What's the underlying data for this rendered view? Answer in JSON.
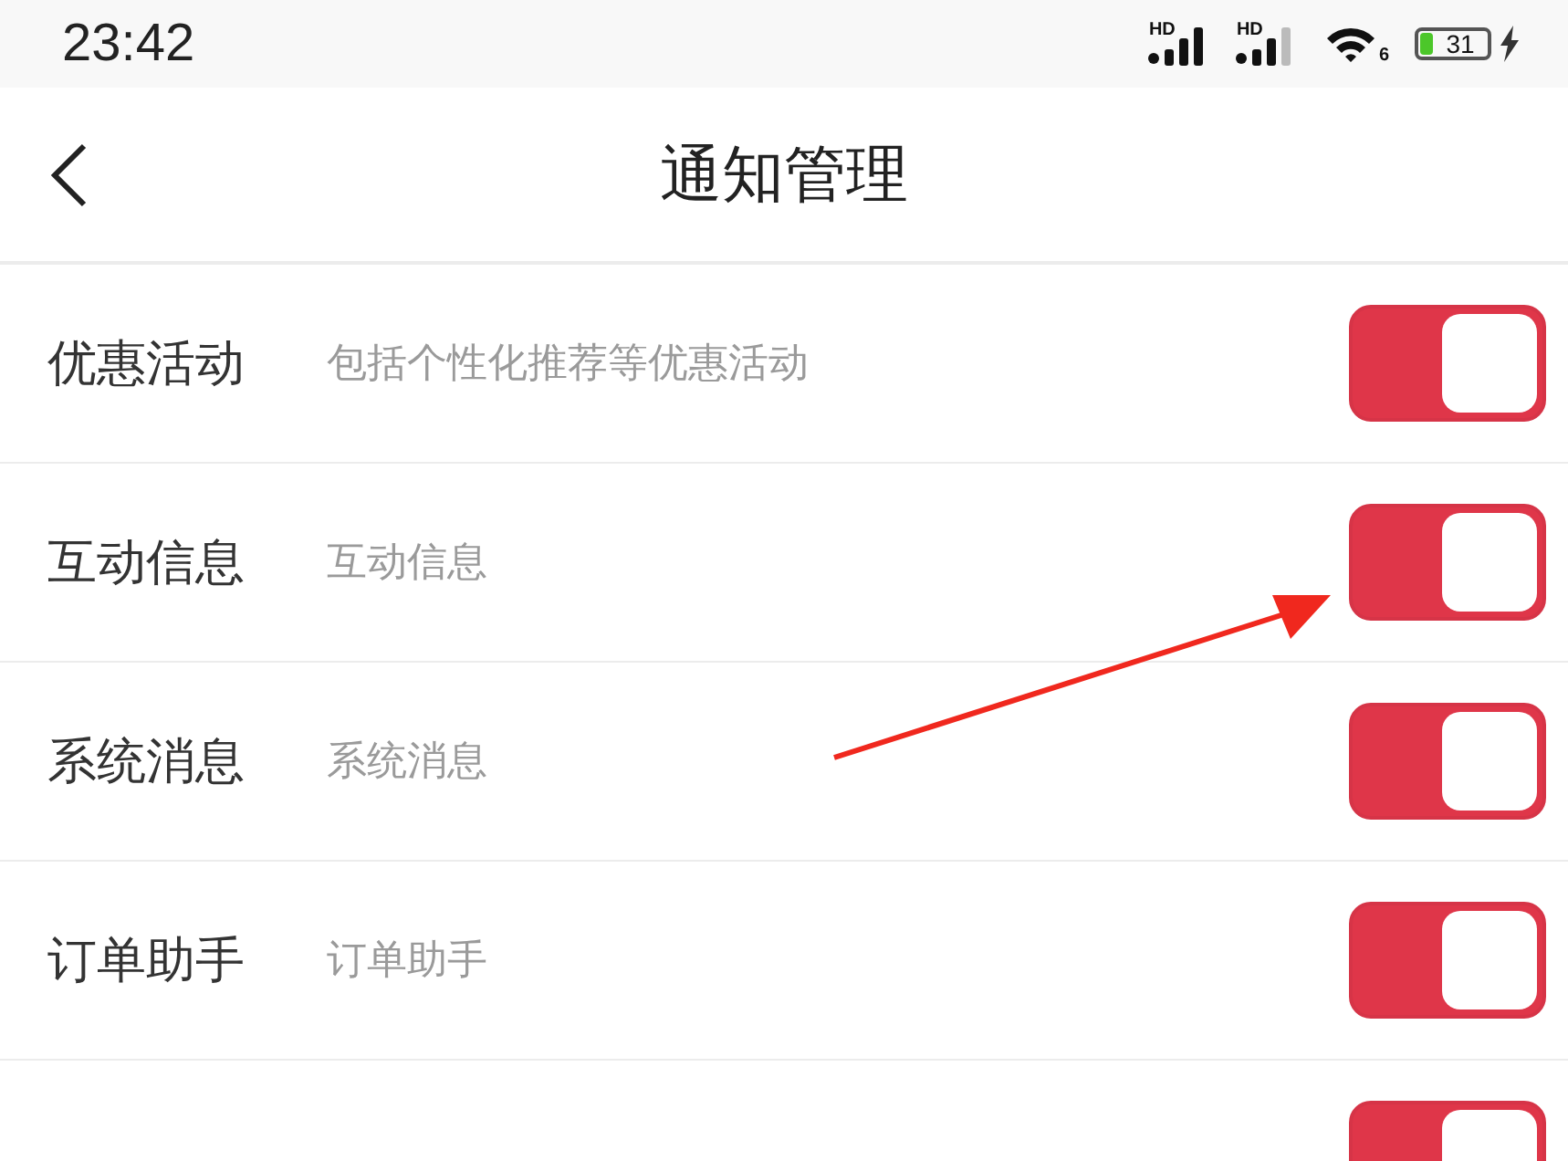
{
  "status_bar": {
    "time": "23:42",
    "signal_labels": [
      "HD",
      "HD"
    ],
    "wifi_label": "6",
    "battery": "31"
  },
  "header": {
    "title": "通知管理"
  },
  "settings": [
    {
      "name": "优惠活动",
      "description": "包括个性化推荐等优惠活动",
      "on": true
    },
    {
      "name": "互动信息",
      "description": "互动信息",
      "on": true
    },
    {
      "name": "系统消息",
      "description": "系统消息",
      "on": true
    },
    {
      "name": "订单助手",
      "description": "订单助手",
      "on": true
    },
    {
      "on": true
    }
  ]
}
